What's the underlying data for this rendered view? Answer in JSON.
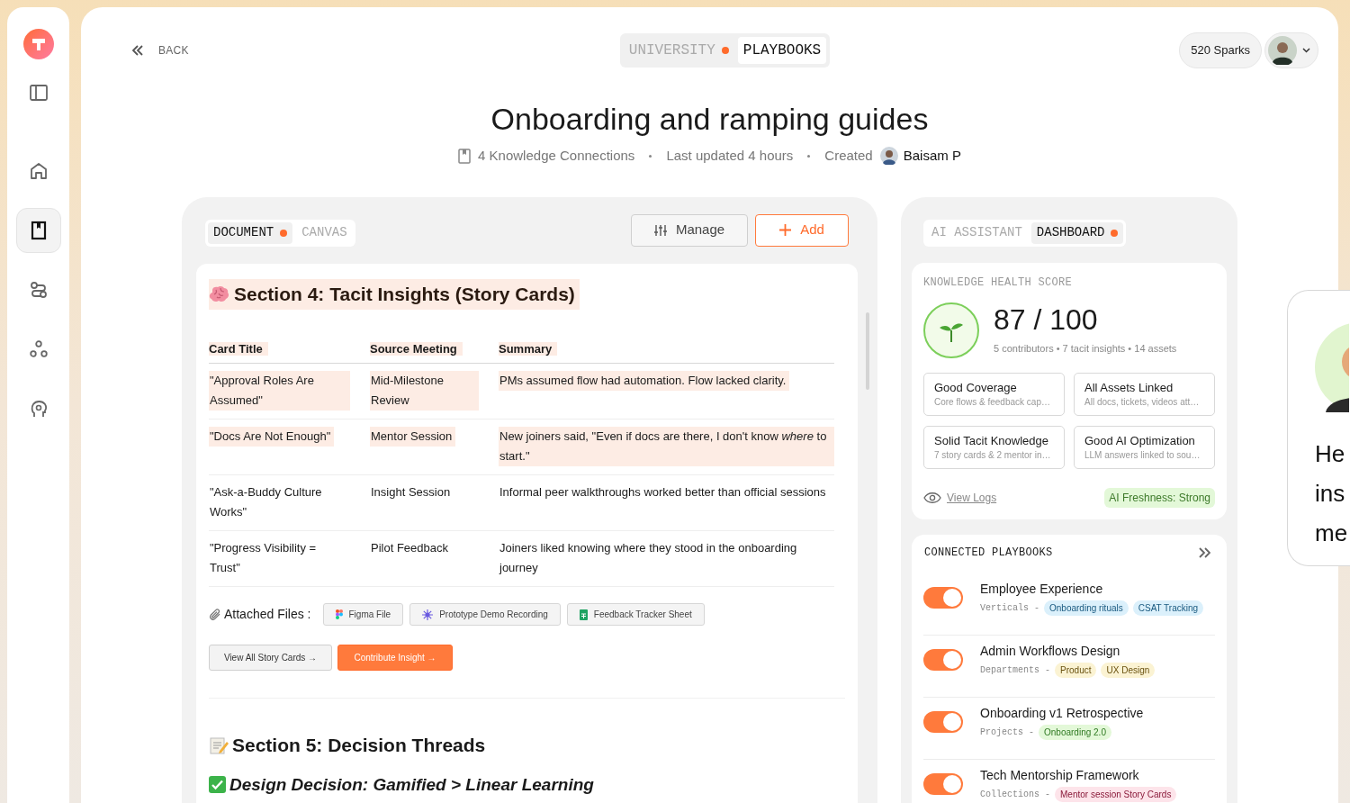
{
  "sidebar": {
    "items": [
      {
        "kind": "panel",
        "selected": false
      },
      {
        "kind": "home",
        "selected": false
      },
      {
        "kind": "book",
        "selected": true
      },
      {
        "kind": "route",
        "selected": false
      },
      {
        "kind": "nodes",
        "selected": false
      },
      {
        "kind": "head",
        "selected": false
      }
    ]
  },
  "back": {
    "label": "BACK"
  },
  "top_tabs": [
    {
      "label": "UNIVERSITY",
      "selected": false,
      "dot": true
    },
    {
      "label": "PLAYBOOKS",
      "selected": true,
      "dot": false
    }
  ],
  "sparks": "520 Sparks",
  "title": "Onboarding and ramping guides",
  "meta": {
    "connections": "4 Knowledge Connections",
    "updated": "Last updated 4 hours",
    "created_label": "Created",
    "creator": "Baisam P"
  },
  "document_panel": {
    "tabs": [
      {
        "label": "DOCUMENT",
        "selected": true,
        "dot": true
      },
      {
        "label": "CANVAS",
        "selected": false,
        "dot": false
      }
    ],
    "buttons": [
      {
        "label": "Manage",
        "kind": "manage"
      },
      {
        "label": "Add",
        "kind": "add"
      }
    ],
    "section4": {
      "heading": "Section 4: Tacit Insights (Story Cards)",
      "table": {
        "columns": [
          "Card Title",
          "Source Meeting",
          "Summary"
        ],
        "rows": [
          {
            "highlighted": true,
            "cells": [
              "\"Approval Roles Are Assumed\"",
              "Mid-Milestone Review",
              "PMs assumed flow had automation. Flow lacked clarity."
            ]
          },
          {
            "highlighted": true,
            "cells": [
              "\"Docs Are Not Enough\"",
              "Mentor Session",
              "New joiners said, \"Even if docs are there, I don't know *where* to start.\""
            ]
          },
          {
            "highlighted": false,
            "cells": [
              "\"Ask-a-Buddy Culture Works\"",
              "Insight Session",
              "Informal peer walkthroughs worked better than official sessions"
            ]
          },
          {
            "highlighted": false,
            "cells": [
              "\"Progress Visibility = Trust\"",
              "Pilot Feedback",
              "Joiners liked knowing where they stood in the onboarding journey"
            ]
          }
        ]
      },
      "attached_label": "Attached Files :",
      "files": [
        {
          "name": "Figma File",
          "kind": "figma"
        },
        {
          "name": "Prototype Demo Recording",
          "kind": "recording"
        },
        {
          "name": "Feedback Tracker Sheet",
          "kind": "sheet"
        }
      ],
      "actions": [
        {
          "label": "View All Story Cards →",
          "kind": "secondary"
        },
        {
          "label": "Contribute Insight →",
          "kind": "primary"
        }
      ]
    },
    "section5": {
      "heading": "Section 5: Decision Threads",
      "decision": "Design Decision: Gamified > Linear Learning"
    }
  },
  "right_panel": {
    "tabs": [
      {
        "label": "AI ASSISTANT",
        "selected": false,
        "dot": false
      },
      {
        "label": "DASHBOARD",
        "selected": true,
        "dot": true
      }
    ],
    "health": {
      "label": "KNOWLEDGE HEALTH SCORE",
      "score": "87 / 100",
      "stats": "5 contributors • 7 tacit insights • 14 assets",
      "items": [
        {
          "title": "Good Coverage",
          "detail": "Core flows & feedback cap…"
        },
        {
          "title": "All Assets Linked",
          "detail": "All docs, tickets, videos att…"
        },
        {
          "title": "Solid Tacit Knowledge",
          "detail": "7 story cards & 2 mentor in…"
        },
        {
          "title": "Good AI Optimization",
          "detail": "LLM answers linked to sou…"
        }
      ],
      "view_logs": "View Logs",
      "freshness": "AI Freshness: Strong"
    },
    "playbooks": {
      "label": "CONNECTED PLAYBOOKS",
      "items": [
        {
          "title": "Employee Experience",
          "on": true,
          "group": "Verticals -",
          "tags": [
            {
              "label": "Onboarding rituals",
              "color": "#dbf0fb"
            },
            {
              "label": "CSAT Tracking",
              "color": "#dbf0fb"
            }
          ]
        },
        {
          "title": "Admin Workflows Design",
          "on": true,
          "group": "Departments -",
          "tags": [
            {
              "label": "Product",
              "color": "#fbf3d3"
            },
            {
              "label": "UX Design",
              "color": "#fbf3d3"
            }
          ]
        },
        {
          "title": "Onboarding v1 Retrospective",
          "on": true,
          "group": "Projects -",
          "tags": [
            {
              "label": "Onboarding 2.0",
              "color": "#e3f8d8"
            }
          ]
        },
        {
          "title": "Tech Mentorship Framework",
          "on": true,
          "group": "Collections -",
          "tags": [
            {
              "label": "Mentor session Story Cards",
              "color": "#fde4ea"
            }
          ]
        }
      ]
    }
  },
  "side_card": {
    "lines": [
      "He",
      "ins",
      "me"
    ]
  }
}
